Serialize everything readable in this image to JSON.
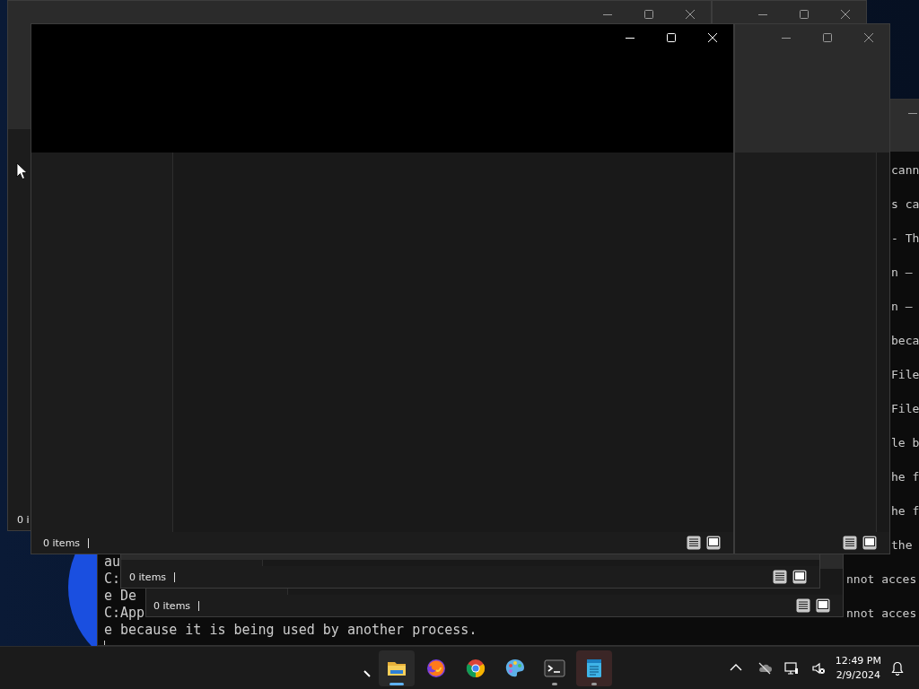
{
  "windows": [
    {
      "kind": "terminal",
      "focused": false,
      "cursor": true,
      "lines": [
        {
          "kind": "text",
          "right": "cann"
        },
        {
          "kind": "blank"
        },
        {
          "kind": "text",
          "right": "s ca"
        },
        {
          "kind": "blank"
        },
        {
          "kind": "text",
          "right": "- Th"
        },
        {
          "kind": "blank"
        },
        {
          "kind": "text",
          "right": "n –"
        },
        {
          "kind": "blank"
        },
        {
          "kind": "text",
          "right": "n –"
        },
        {
          "kind": "blank"
        },
        {
          "kind": "text",
          "right": "beca"
        },
        {
          "kind": "blank"
        },
        {
          "kind": "text",
          "right": "File"
        },
        {
          "kind": "blank"
        },
        {
          "kind": "text",
          "right": "File"
        },
        {
          "kind": "blank"
        },
        {
          "kind": "text",
          "right": "le b"
        },
        {
          "kind": "blank"
        },
        {
          "kind": "text",
          "right": "he f"
        },
        {
          "kind": "blank"
        },
        {
          "kind": "text",
          "right": "he f"
        },
        {
          "kind": "blank"
        },
        {
          "kind": "text",
          "right": "the"
        },
        {
          "kind": "text",
          "left": "au"
        },
        {
          "kind": "text",
          "left": "C:",
          "right": "nnot acces"
        },
        {
          "kind": "text",
          "left": "e De"
        },
        {
          "kind": "text",
          "left": "C:App",
          "right": "nnot acces"
        },
        {
          "kind": "text",
          "left": "e because it is being used by another process."
        }
      ]
    },
    {
      "kind": "explorer",
      "focused": false,
      "loading": false,
      "status": "0 i"
    },
    {
      "kind": "explorer",
      "focused": false,
      "loading": false
    },
    {
      "kind": "explorer",
      "status": "0 items"
    },
    {
      "kind": "explorer",
      "status": "0 items"
    },
    {
      "kind": "explorer",
      "focused": false,
      "loading": false
    },
    {
      "kind": "explorer",
      "focused": true,
      "loading": true,
      "status": "0 items"
    }
  ],
  "taskbar": {
    "apps": [
      {
        "kind": "folder",
        "active": true,
        "running": true,
        "hover": false
      },
      {
        "kind": "fox",
        "active": false,
        "running": false,
        "hover": false
      },
      {
        "kind": "chrome",
        "active": false,
        "running": false,
        "hover": false
      },
      {
        "kind": "palette",
        "active": false,
        "running": false,
        "hover": false
      },
      {
        "kind": "terminal",
        "active": false,
        "running": true,
        "hover": false
      },
      {
        "kind": "notepad",
        "active": false,
        "running": true,
        "hover": true
      }
    ],
    "time": "12:49 PM",
    "date": "2/9/2024"
  }
}
